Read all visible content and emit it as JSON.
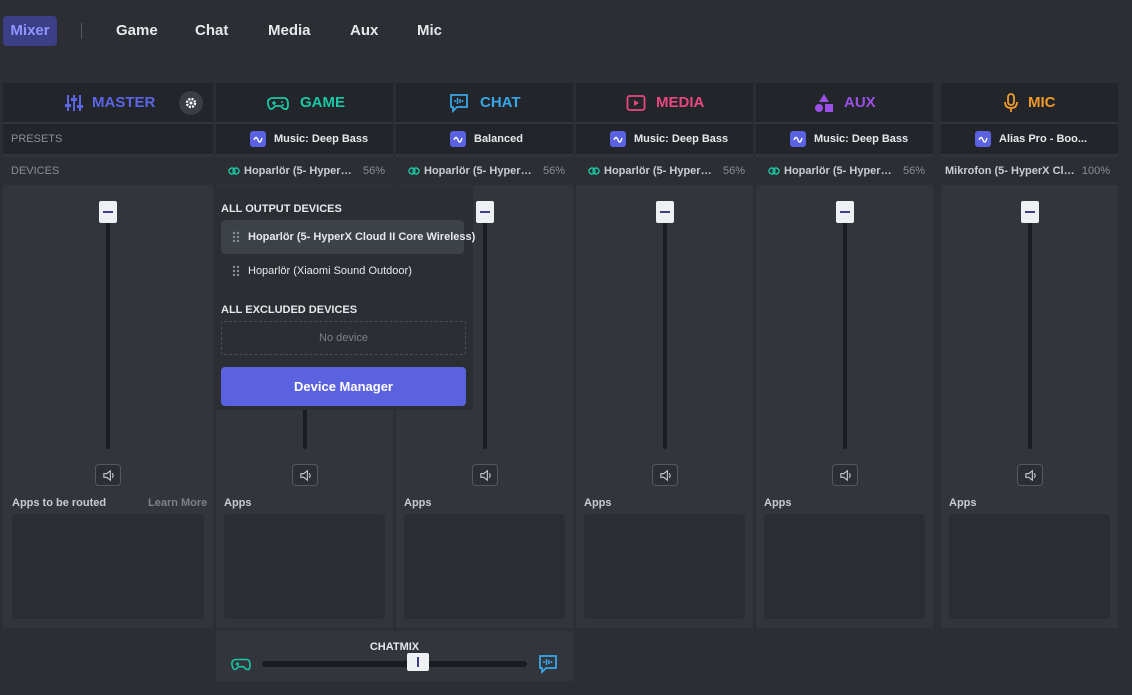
{
  "nav": {
    "items": [
      "Mixer",
      "Game",
      "Chat",
      "Media",
      "Aux",
      "Mic"
    ],
    "active": "Mixer"
  },
  "labels": {
    "presets": "PRESETS",
    "devices": "DEVICES",
    "apps_to_be_routed": "Apps to be routed",
    "learn_more": "Learn More",
    "apps": "Apps"
  },
  "colors": {
    "master": "#5b65e6",
    "game": "#19c7a4",
    "chat": "#38a8e8",
    "media": "#e8487f",
    "aux": "#9b50e8",
    "mic": "#f09a2a",
    "accent": "#5a62e0"
  },
  "channels": {
    "master": {
      "title": "MASTER",
      "icon": "sliders-icon"
    },
    "game": {
      "title": "GAME",
      "icon": "gamepad-icon",
      "preset": "Music: Deep Bass",
      "device": "Hoparlör (5- HyperX ...",
      "volume": "56%"
    },
    "chat": {
      "title": "CHAT",
      "icon": "chat-waveform-icon",
      "preset": "Balanced",
      "device": "Hoparlör (5- HyperX ...",
      "volume": "56%"
    },
    "media": {
      "title": "MEDIA",
      "icon": "play-icon",
      "preset": "Music: Deep Bass",
      "device": "Hoparlör (5- HyperX ...",
      "volume": "56%"
    },
    "aux": {
      "title": "AUX",
      "icon": "shapes-icon",
      "preset": "Music: Deep Bass",
      "device": "Hoparlör (5- HyperX ...",
      "volume": "56%"
    },
    "mic": {
      "title": "MIC",
      "icon": "microphone-icon",
      "preset": "Alias Pro - Boo...",
      "device": "Mikrofon (5- HyperX Clou...",
      "volume": "100%"
    }
  },
  "dropdown": {
    "output_header": "ALL OUTPUT DEVICES",
    "outputs": [
      "Hoparlör (5- HyperX Cloud II Core Wireless)",
      "Hoparlör (Xiaomi Sound Outdoor)"
    ],
    "excluded_header": "ALL EXCLUDED DEVICES",
    "excluded_empty": "No device",
    "button": "Device Manager"
  },
  "chatmix": {
    "title": "CHATMIX",
    "level_fraction": 0.5
  }
}
